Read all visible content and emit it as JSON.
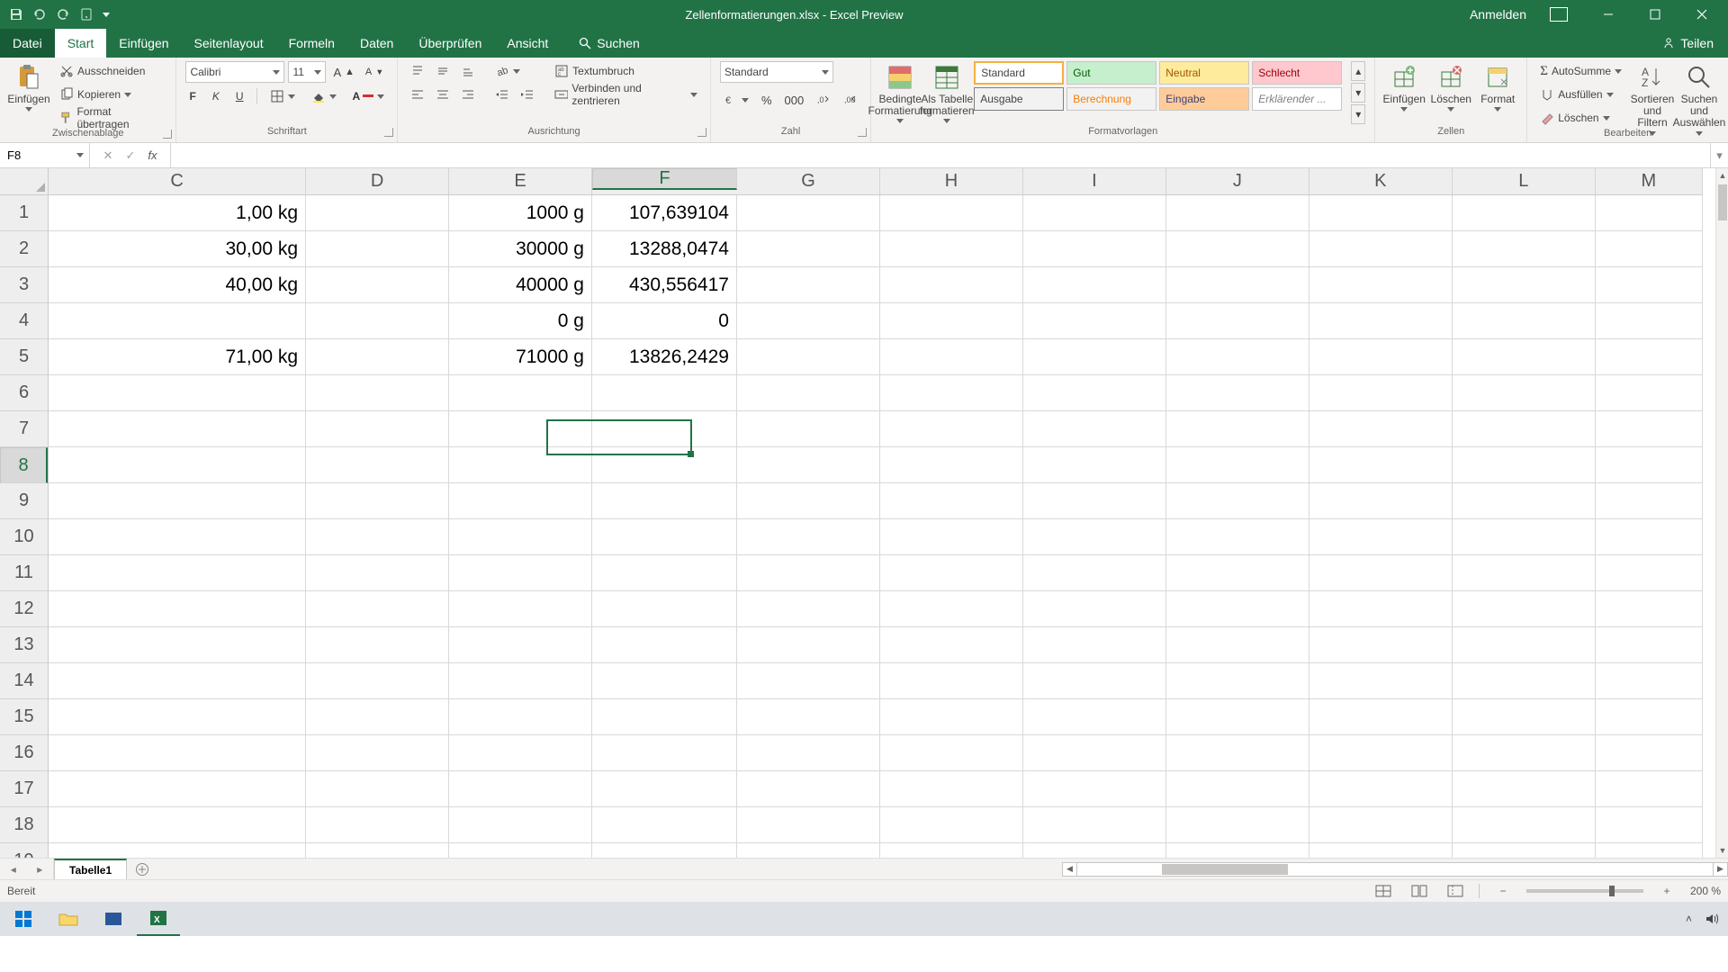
{
  "titlebar": {
    "title": "Zellenformatierungen.xlsx - Excel Preview",
    "login": "Anmelden"
  },
  "tabs": {
    "file": "Datei",
    "items": [
      "Start",
      "Einfügen",
      "Seitenlayout",
      "Formeln",
      "Daten",
      "Überprüfen",
      "Ansicht"
    ],
    "search": "Suchen",
    "share": "Teilen"
  },
  "ribbon": {
    "clipboard": {
      "paste": "Einfügen",
      "cut": "Ausschneiden",
      "copy": "Kopieren",
      "painter": "Format übertragen",
      "label": "Zwischenablage"
    },
    "font": {
      "name": "Calibri",
      "size": "11",
      "label": "Schriftart"
    },
    "align": {
      "wrap": "Textumbruch",
      "merge": "Verbinden und zentrieren",
      "label": "Ausrichtung"
    },
    "number": {
      "format": "Standard",
      "label": "Zahl"
    },
    "styles": {
      "cond": "Bedingte\nFormatierung",
      "astable": "Als Tabelle\nformatieren",
      "cells": [
        "Standard",
        "Gut",
        "Neutral",
        "Schlecht",
        "Ausgabe",
        "Berechnung",
        "Eingabe",
        "Erklärender ..."
      ],
      "label": "Formatvorlagen"
    },
    "cells_grp": {
      "insert": "Einfügen",
      "delete": "Löschen",
      "format": "Format",
      "label": "Zellen"
    },
    "editing": {
      "sum": "AutoSumme",
      "fill": "Ausfüllen",
      "clear": "Löschen",
      "sort": "Sortieren und\nFiltern",
      "find": "Suchen und\nAuswählen",
      "label": "Bearbeiten"
    }
  },
  "fx": {
    "name": "F8",
    "formula": ""
  },
  "columns": [
    "C",
    "D",
    "E",
    "F",
    "G",
    "H",
    "I",
    "J",
    "K",
    "L",
    "M"
  ],
  "col_widths": [
    "wC",
    "wD",
    "wE",
    "wF",
    "wG",
    "wH",
    "wI",
    "wJ",
    "wK",
    "wL",
    "wM"
  ],
  "selected_col": "F",
  "selected_row": 8,
  "row_count": 19,
  "cells": {
    "1": {
      "C": "1,00 kg",
      "E": "1000  g",
      "F": "107,639104"
    },
    "2": {
      "C": "30,00 kg",
      "E": "30000  g",
      "F": "13288,0474"
    },
    "3": {
      "C": "40,00 kg",
      "E": "40000  g",
      "F": "430,556417"
    },
    "4": {
      "E": "0  g",
      "F": "0"
    },
    "5": {
      "C": "71,00 kg",
      "E": "71000  g",
      "F": "13826,2429"
    }
  },
  "sheettab": "Tabelle1",
  "status": {
    "ready": "Bereit",
    "zoom": "200 %"
  }
}
